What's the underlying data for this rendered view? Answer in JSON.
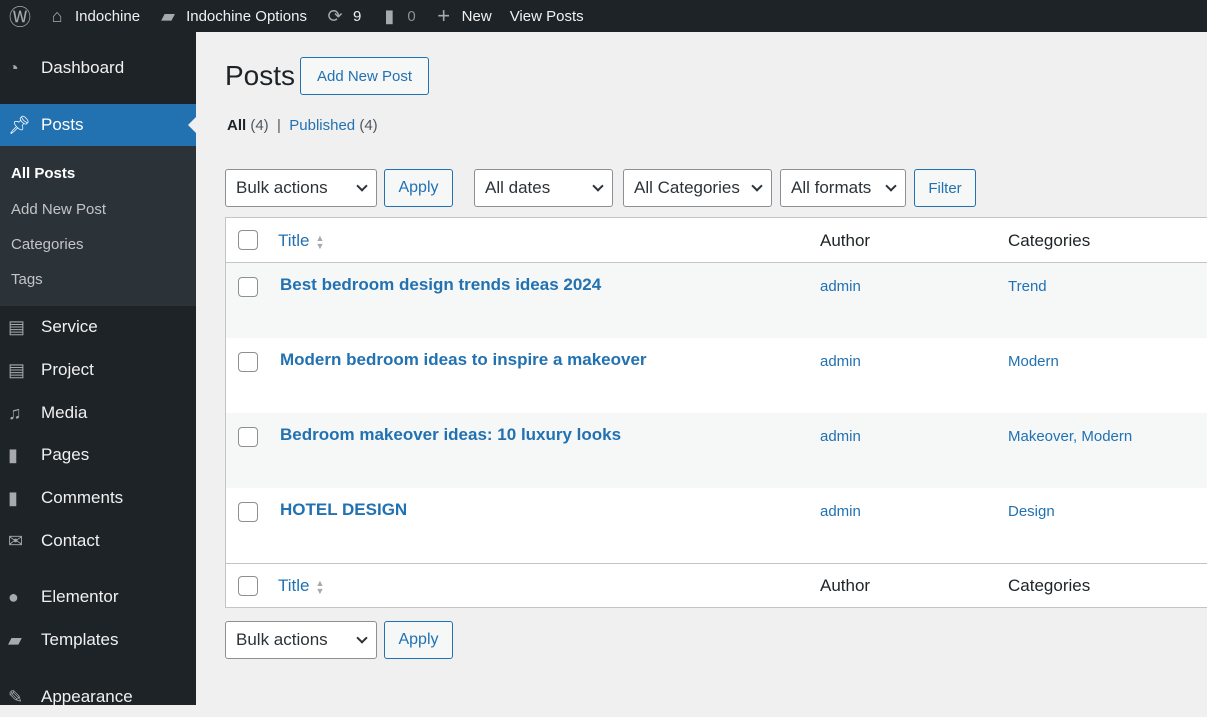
{
  "adminbar": {
    "site": "Indochine",
    "options": "Indochine Options",
    "updates": "9",
    "comments": "0",
    "new": "New",
    "view": "View Posts"
  },
  "sidebar": {
    "items": [
      {
        "label": "Dashboard",
        "icon": "dashboard-icon"
      },
      {
        "label": "Posts",
        "icon": "pin-icon"
      },
      {
        "label": "Service",
        "icon": "id-card-icon"
      },
      {
        "label": "Project",
        "icon": "id-card-icon"
      },
      {
        "label": "Media",
        "icon": "media-icon"
      },
      {
        "label": "Pages",
        "icon": "pages-icon"
      },
      {
        "label": "Comments",
        "icon": "comment-icon"
      },
      {
        "label": "Contact",
        "icon": "envelope-icon"
      },
      {
        "label": "Elementor",
        "icon": "elementor-icon"
      },
      {
        "label": "Templates",
        "icon": "folder-icon"
      },
      {
        "label": "Appearance",
        "icon": "brush-icon"
      }
    ],
    "submenu": [
      "All Posts",
      "Add New Post",
      "Categories",
      "Tags"
    ]
  },
  "main": {
    "title": "Posts",
    "add_new": "Add New Post",
    "filters": {
      "all": "All",
      "all_count": "(4)",
      "published": "Published",
      "published_count": "(4)"
    },
    "bulk": "Bulk actions",
    "apply": "Apply",
    "dates": "All dates",
    "categories": "All Categories",
    "formats": "All formats",
    "filter": "Filter",
    "columns": {
      "title": "Title",
      "author": "Author",
      "categories": "Categories"
    },
    "rows": [
      {
        "title": "Best bedroom design trends ideas 2024",
        "author": "admin",
        "categories": "Trend"
      },
      {
        "title": "Modern bedroom ideas to inspire a makeover",
        "author": "admin",
        "categories": "Modern"
      },
      {
        "title": "Bedroom makeover ideas: 10 luxury looks",
        "author": "admin",
        "categories": "Makeover, Modern"
      },
      {
        "title": "HOTEL DESIGN",
        "author": "admin",
        "categories": "Design"
      }
    ]
  },
  "colors": {
    "accent": "#2271b1",
    "menu_bg": "#1d2327",
    "submenu_bg": "#2c3338"
  }
}
